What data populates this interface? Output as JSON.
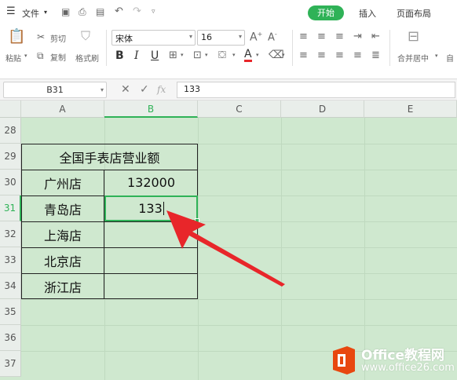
{
  "menubar": {
    "menu_icon": "hamburger-icon",
    "file_label": "文件",
    "quick_icons": [
      "save-icon",
      "print-icon",
      "print-preview-icon",
      "undo-icon",
      "redo-icon",
      "customize-icon"
    ],
    "tabs": [
      "开始",
      "插入",
      "页面布局"
    ],
    "active_tab_color": "#2fb257"
  },
  "ribbon": {
    "paste_label": "粘贴",
    "cut_label": "剪切",
    "copy_label": "复制",
    "format_painter_label": "格式刷",
    "font_name": "宋体",
    "font_size": "16",
    "bold": "B",
    "italic": "I",
    "underline": "U",
    "font_color": "A",
    "merge_label": "合并居中",
    "next_label": "自"
  },
  "formula_bar": {
    "name_box": "B31",
    "cancel": "✕",
    "confirm": "✓",
    "fx": "fx",
    "value": "133"
  },
  "sheet": {
    "columns": [
      "A",
      "B",
      "C",
      "D",
      "E"
    ],
    "rows": [
      "28",
      "29",
      "30",
      "31",
      "32",
      "33",
      "34",
      "35",
      "36",
      "37"
    ],
    "title": "全国手表店营业额",
    "stores": [
      "广州店",
      "青岛店",
      "上海店",
      "北京店",
      "浙江店"
    ],
    "values": [
      "132000",
      "133",
      "",
      "",
      ""
    ],
    "active_cell": "B31",
    "grid_color": "#cfe8cf",
    "arrow_color": "#e8262a"
  },
  "watermark": {
    "brand": "Office教程网",
    "url": "www.office26.com",
    "logo_color": "#e8470f"
  }
}
